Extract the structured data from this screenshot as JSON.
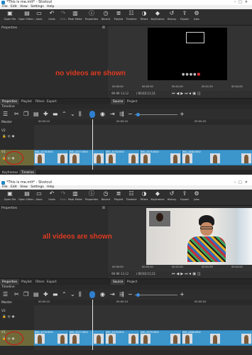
{
  "screens": [
    {
      "window_title": "*This is me.mlt* - Shotcut",
      "menu": [
        "File",
        "Edit",
        "View",
        "Settings",
        "Help"
      ],
      "toolbar": [
        {
          "label": "Open File",
          "icon": "folder-open-icon"
        },
        {
          "label": "Open Other...",
          "icon": "open-other-icon"
        },
        {
          "label": "Save",
          "icon": "save-icon"
        },
        {
          "label": "Undo",
          "icon": "undo-icon"
        },
        {
          "label": "Redo",
          "icon": "redo-icon"
        },
        {
          "label": "Peak Meter",
          "icon": "peak-meter-icon"
        },
        {
          "label": "Properties",
          "icon": "properties-icon"
        },
        {
          "label": "Recent",
          "icon": "recent-icon"
        },
        {
          "label": "Playlist",
          "icon": "playlist-icon"
        },
        {
          "label": "Timeline",
          "icon": "timeline-icon"
        },
        {
          "label": "Filters",
          "icon": "filters-icon"
        },
        {
          "label": "Keyframes",
          "icon": "keyframes-icon"
        },
        {
          "label": "History",
          "icon": "history-icon"
        },
        {
          "label": "Export",
          "icon": "export-icon"
        },
        {
          "label": "Jobs",
          "icon": "jobs-icon"
        }
      ],
      "properties_title": "Properties",
      "viewer_ticks": [
        "00:00:00",
        "00:00:30",
        "00:01:00",
        "00:01:30",
        "00:02:00"
      ],
      "timecode_current": "00:00:13;12",
      "timecode_total": "/ 00:02:11;11",
      "panel_tabs": [
        "Properties",
        "Playlist",
        "Filters",
        "Export"
      ],
      "source_tabs": [
        "Source",
        "Project"
      ],
      "timeline_title": "Timeline",
      "ruler_ticks": [
        "00:00:10",
        "00:00:15",
        "00:00:20"
      ],
      "tracks": [
        "Master",
        "V2",
        "V1"
      ],
      "clips": [
        "IMG_4376.MOV",
        "IMG_4377.MOV",
        "IMG_4378.MOV",
        "IMG_4379.MOV",
        "IMG_4380.MOV"
      ],
      "bottom_tabs": [
        "Keyframes",
        "Timeline"
      ],
      "annotation": "no videos are shown",
      "video_visible": false
    },
    {
      "window_title": "*This is me.mlt* - Shotcut",
      "menu": [
        "File",
        "Edit",
        "View",
        "Settings",
        "Help"
      ],
      "toolbar": [
        {
          "label": "Open File",
          "icon": "folder-open-icon"
        },
        {
          "label": "Open Other...",
          "icon": "open-other-icon"
        },
        {
          "label": "Save",
          "icon": "save-icon"
        },
        {
          "label": "Undo",
          "icon": "undo-icon"
        },
        {
          "label": "Redo",
          "icon": "redo-icon"
        },
        {
          "label": "Peak Meter",
          "icon": "peak-meter-icon"
        },
        {
          "label": "Properties",
          "icon": "properties-icon"
        },
        {
          "label": "Recent",
          "icon": "recent-icon"
        },
        {
          "label": "Playlist",
          "icon": "playlist-icon"
        },
        {
          "label": "Timeline",
          "icon": "timeline-icon"
        },
        {
          "label": "Filters",
          "icon": "filters-icon"
        },
        {
          "label": "Keyframes",
          "icon": "keyframes-icon"
        },
        {
          "label": "History",
          "icon": "history-icon"
        },
        {
          "label": "Export",
          "icon": "export-icon"
        },
        {
          "label": "Jobs",
          "icon": "jobs-icon"
        }
      ],
      "properties_title": "Properties",
      "viewer_ticks": [
        "00:00:00",
        "00:00:30",
        "00:01:00",
        "00:01:30",
        "00:02:00"
      ],
      "timecode_current": "00:00:13;12",
      "timecode_total": "/ 00:02:11;11",
      "panel_tabs": [
        "Properties",
        "Playlist",
        "Filters",
        "Export"
      ],
      "source_tabs": [
        "Source",
        "Project"
      ],
      "timeline_title": "Timeline",
      "ruler_ticks": [
        "00:00:10",
        "00:00:15",
        "00:00:20"
      ],
      "tracks": [
        "Master",
        "V2",
        "V1"
      ],
      "clips": [
        "IMG_4376.MOV",
        "IMG_4377.MOV",
        "IMG_4378.MOV",
        "IMG_4379.MOV",
        "IMG_4380.MOV"
      ],
      "bottom_tabs": [],
      "annotation": "all videos are shown",
      "video_visible": true
    }
  ],
  "colors": {
    "annotation": "#e03a20",
    "highlight_ring": "#d01010",
    "clip": "#3c96cc",
    "track_selected": "#6f6a3a",
    "snap_accent": "#2f7fd0"
  }
}
